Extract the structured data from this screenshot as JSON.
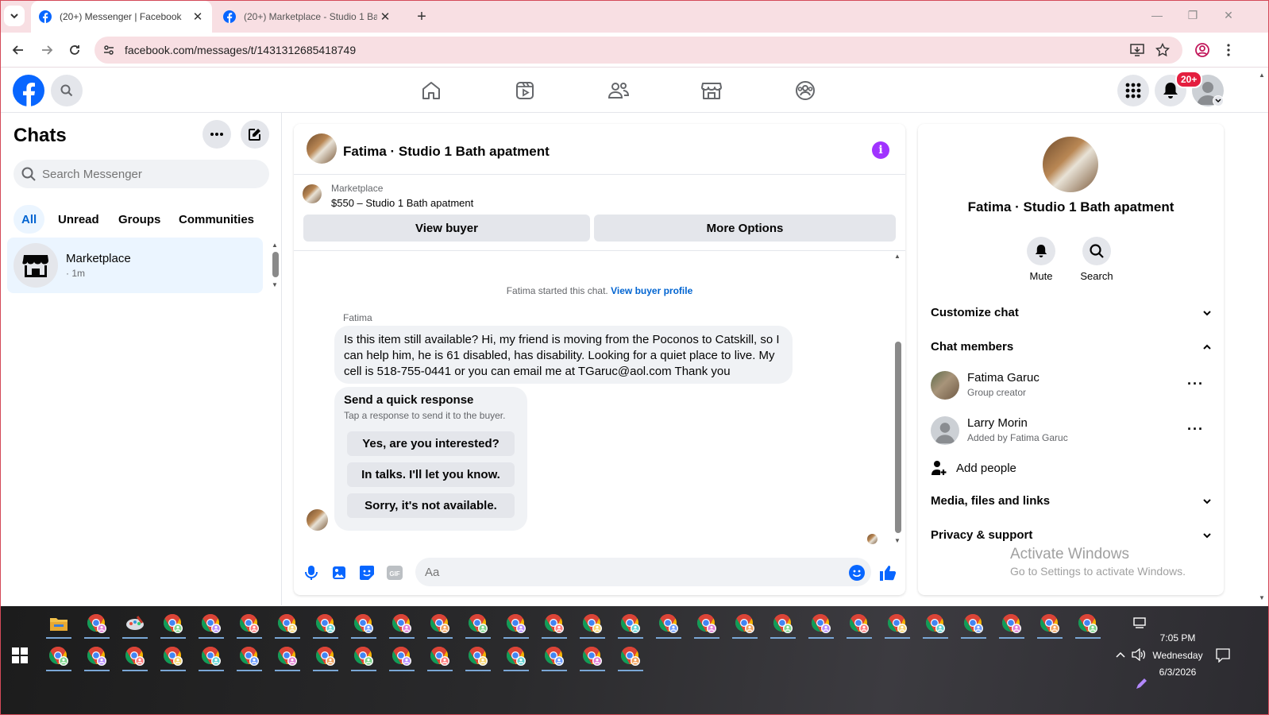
{
  "browser": {
    "tabs": [
      {
        "title": "(20+) Messenger | Facebook",
        "active": true
      },
      {
        "title": "(20+) Marketplace - Studio 1 Ba",
        "active": false
      }
    ],
    "url": "facebook.com/messages/t/1431312685418749"
  },
  "header": {
    "notification_badge": "20+"
  },
  "chats": {
    "title": "Chats",
    "search_placeholder": "Search Messenger",
    "filters": [
      "All",
      "Unread",
      "Groups",
      "Communities"
    ],
    "items": [
      {
        "name": "Marketplace",
        "meta": "· 1m"
      }
    ]
  },
  "conversation": {
    "title": "Fatima · Studio 1 Bath apatment",
    "marketplace_label": "Marketplace",
    "listing": "$550 – Studio 1 Bath apatment",
    "view_buyer_label": "View buyer",
    "more_options_label": "More Options",
    "started_text": "Fatima started this chat.",
    "view_buyer_profile": "View buyer profile",
    "sender": "Fatima",
    "message": "Is this item still available? Hi, my friend is moving from the Poconos to Catskill, so I can help him, he is 61 disabled, has disability. Looking for a quiet place to live. My cell is 518-755-0441 or you can email me at TGaruc@aol.com Thank you",
    "quick_response": {
      "title": "Send a quick response",
      "subtitle": "Tap a response to send it to the buyer.",
      "options": [
        "Yes, are you interested?",
        "In talks. I'll let you know.",
        "Sorry, it's not available."
      ]
    },
    "composer_placeholder": "Aa"
  },
  "info_panel": {
    "title": "Fatima · Studio 1 Bath apatment",
    "actions": [
      {
        "label": "Mute"
      },
      {
        "label": "Search"
      }
    ],
    "sections": {
      "customize": "Customize chat",
      "members": "Chat members",
      "add_people": "Add people",
      "media": "Media, files and links",
      "privacy": "Privacy & support"
    },
    "members": [
      {
        "name": "Fatima Garuc",
        "role": "Group creator"
      },
      {
        "name": "Larry Morin",
        "role": "Added by Fatima Garuc"
      }
    ]
  },
  "watermark": {
    "line1": "Activate Windows",
    "line2": "Go to Settings to activate Windows."
  },
  "taskbar": {
    "time": "7:05 PM",
    "day": "Wednesday",
    "date": "6/3/2026"
  },
  "colors": {
    "fb_blue": "#0866ff",
    "tab_strip": "#f8dfe3",
    "info_purple": "#a033ff",
    "selected_chat": "#ebf5ff"
  }
}
